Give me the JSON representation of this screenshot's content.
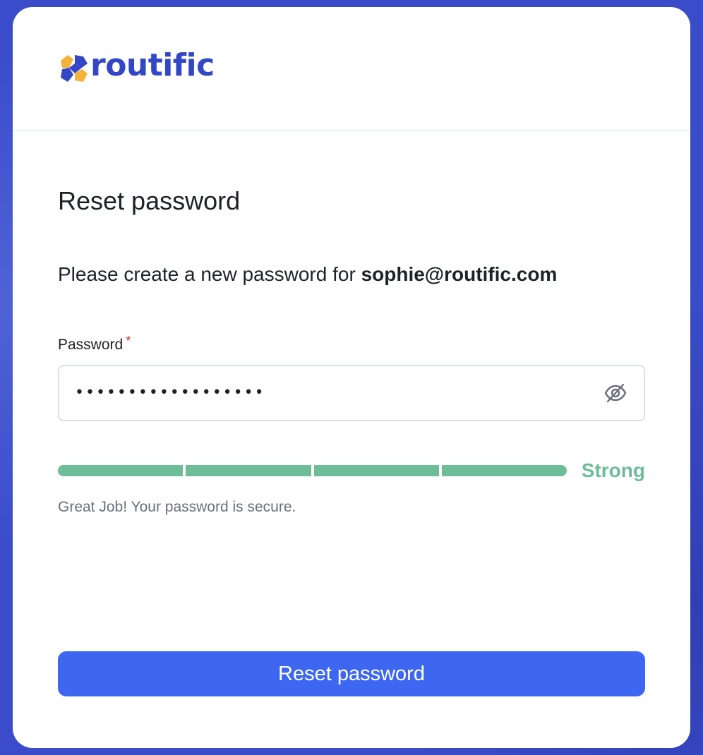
{
  "brand": {
    "logo_text": "routific",
    "logo_icon": "routific-flower-logo-icon",
    "primary_color": "#3346c6",
    "accent_color": "#f3b23a"
  },
  "form": {
    "title": "Reset password",
    "subtitle_prefix": "Please create a new password for ",
    "email": "sophie@routific.com",
    "password_label": "Password",
    "required_marker": "*",
    "password_masked": "••••••••••••••••••",
    "visibility_icon": "eye-off-icon",
    "strength": {
      "label": "Strong",
      "segments_filled": 4,
      "segments_total": 4,
      "color": "#6dbd99",
      "message": "Great Job! Your password is secure."
    },
    "submit_label": "Reset password",
    "submit_color": "#3d67f0"
  }
}
